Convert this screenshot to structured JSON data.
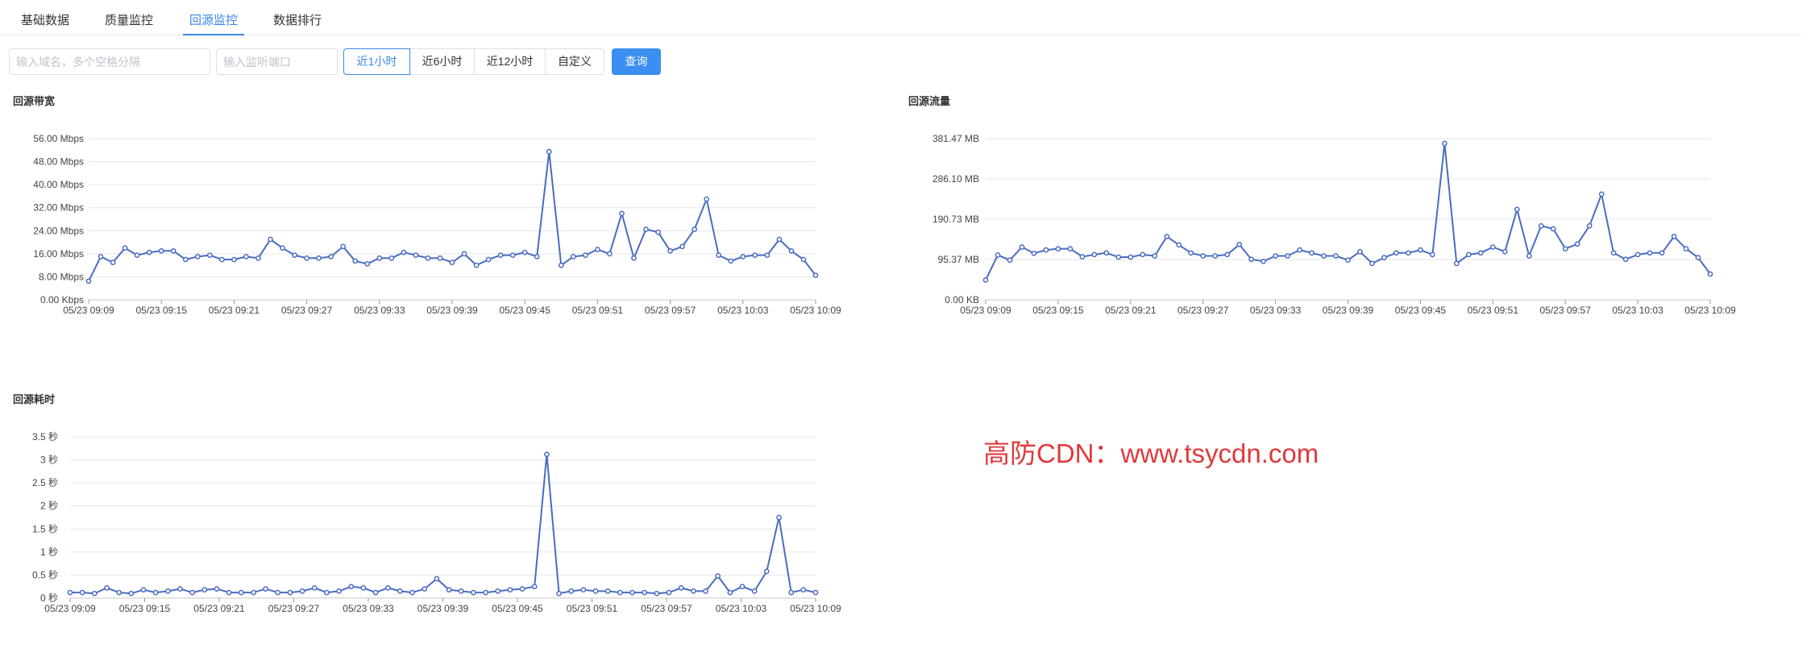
{
  "tabs": [
    {
      "label": "基础数据"
    },
    {
      "label": "质量监控"
    },
    {
      "label": "回源监控",
      "active": true
    },
    {
      "label": "数据排行"
    }
  ],
  "filters": {
    "domain_placeholder": "输入域名，多个空格分隔",
    "port_placeholder": "输入监听端口",
    "ranges": [
      "近1小时",
      "近6小时",
      "近12小时",
      "自定义"
    ],
    "active_range": 0,
    "query_label": "查询"
  },
  "charts": {
    "bandwidth": {
      "title": "回源带宽"
    },
    "traffic": {
      "title": "回源流量"
    },
    "latency": {
      "title": "回源耗时"
    }
  },
  "watermark": "高防CDN：www.tsycdn.com",
  "colors": {
    "accent": "#3b87e8",
    "line": "#4a6cc2"
  },
  "chart_data": [
    {
      "type": "line",
      "title": "回源带宽",
      "yticks": [
        "0.00 Kbps",
        "8.00 Mbps",
        "16.00 Mbps",
        "24.00 Mbps",
        "32.00 Mbps",
        "40.00 Mbps",
        "48.00 Mbps",
        "56.00 Mbps"
      ],
      "ylim": [
        0,
        56
      ],
      "xticks": [
        "05/23 09:09",
        "05/23 09:15",
        "05/23 09:21",
        "05/23 09:27",
        "05/23 09:33",
        "05/23 09:39",
        "05/23 09:45",
        "05/23 09:51",
        "05/23 09:57",
        "05/23 10:03",
        "05/23 10:09"
      ],
      "values": [
        6.5,
        15,
        13,
        18,
        15.5,
        16.5,
        17,
        17,
        14,
        15,
        15.5,
        14,
        14,
        15,
        14.5,
        21,
        18,
        15.5,
        14.5,
        14.5,
        15,
        18.5,
        13.5,
        12.5,
        14.5,
        14.5,
        16.5,
        15.5,
        14.5,
        14.5,
        13,
        16,
        12,
        14,
        15.5,
        15.5,
        16.5,
        15,
        51.5,
        12,
        15,
        15.5,
        17.5,
        16,
        30,
        14.5,
        24.5,
        23.5,
        17,
        18.5,
        24.5,
        35,
        15.5,
        13.5,
        15,
        15.5,
        15.5,
        21,
        17,
        14,
        8.5
      ]
    },
    {
      "type": "line",
      "title": "回源流量",
      "yticks": [
        "0.00 KB",
        "95.37 MB",
        "190.73 MB",
        "286.10 MB",
        "381.47 MB"
      ],
      "ylim": [
        0,
        381.47
      ],
      "xticks": [
        "05/23 09:09",
        "05/23 09:15",
        "05/23 09:21",
        "05/23 09:27",
        "05/23 09:33",
        "05/23 09:39",
        "05/23 09:45",
        "05/23 09:51",
        "05/23 09:57",
        "05/23 10:03",
        "05/23 10:09"
      ],
      "values": [
        47,
        106,
        94,
        125,
        110,
        118,
        121,
        121,
        102,
        107,
        111,
        101,
        101,
        107,
        104,
        150,
        130,
        111,
        104,
        104,
        107,
        131,
        96,
        91,
        104,
        104,
        118,
        111,
        104,
        104,
        94,
        114,
        86,
        100,
        111,
        111,
        118,
        107,
        370,
        86,
        107,
        111,
        125,
        114,
        214,
        104,
        175,
        168,
        121,
        132,
        175,
        250,
        111,
        96,
        107,
        111,
        111,
        150,
        121,
        100,
        61
      ]
    },
    {
      "type": "line",
      "title": "回源耗时",
      "yticks": [
        "0 秒",
        "0.5 秒",
        "1 秒",
        "1.5 秒",
        "2 秒",
        "2.5 秒",
        "3 秒",
        "3.5 秒"
      ],
      "ylim": [
        0,
        3.5
      ],
      "xticks": [
        "05/23 09:09",
        "05/23 09:15",
        "05/23 09:21",
        "05/23 09:27",
        "05/23 09:33",
        "05/23 09:39",
        "05/23 09:45",
        "05/23 09:51",
        "05/23 09:57",
        "05/23 10:03",
        "05/23 10:09"
      ],
      "values": [
        0.12,
        0.12,
        0.1,
        0.22,
        0.12,
        0.1,
        0.18,
        0.12,
        0.15,
        0.2,
        0.12,
        0.18,
        0.2,
        0.12,
        0.12,
        0.12,
        0.2,
        0.12,
        0.12,
        0.15,
        0.22,
        0.12,
        0.15,
        0.25,
        0.22,
        0.12,
        0.22,
        0.15,
        0.12,
        0.2,
        0.42,
        0.18,
        0.15,
        0.12,
        0.12,
        0.15,
        0.18,
        0.2,
        0.25,
        3.12,
        0.1,
        0.15,
        0.18,
        0.15,
        0.15,
        0.12,
        0.12,
        0.12,
        0.1,
        0.12,
        0.22,
        0.15,
        0.15,
        0.48,
        0.12,
        0.25,
        0.15,
        0.58,
        1.75,
        0.12,
        0.18,
        0.12
      ]
    }
  ]
}
